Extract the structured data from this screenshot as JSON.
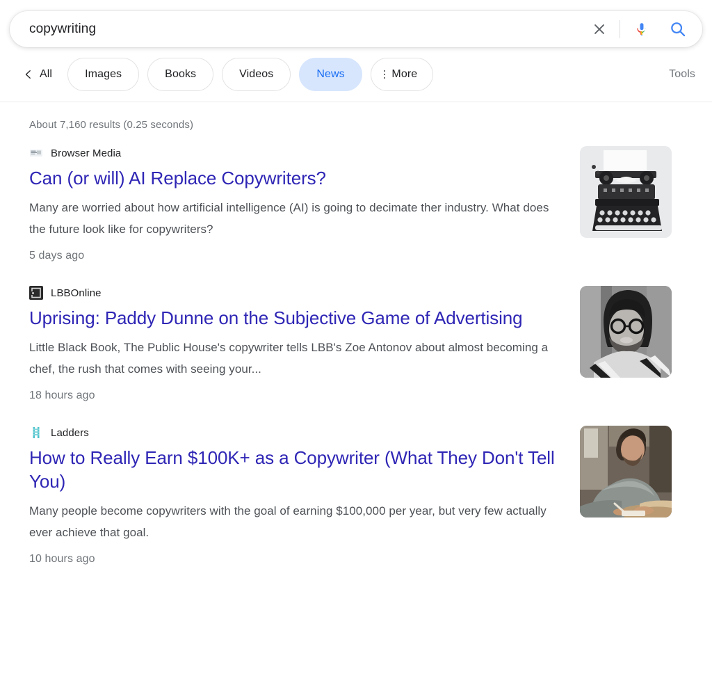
{
  "search": {
    "query": "copywriting",
    "placeholder": "Search",
    "clear_label": "Clear",
    "mic_label": "Search by voice",
    "submit_label": "Google Search"
  },
  "filters": {
    "back_label": "All",
    "chips": [
      {
        "label": "Images",
        "active": false
      },
      {
        "label": "Books",
        "active": false
      },
      {
        "label": "Videos",
        "active": false
      },
      {
        "label": "News",
        "active": true
      },
      {
        "label": "More",
        "active": false
      }
    ],
    "tools_label": "Tools"
  },
  "result_stats": "About 7,160 results (0.25 seconds)",
  "results": [
    {
      "source": "Browser Media",
      "favicon": "browser-media-favicon",
      "title": "Can (or will) AI Replace Copywriters?",
      "snippet": "Many are worried about how artificial intelligence (AI) is going to decimate ther industry. What does the future look like for copywriters?",
      "time": "5 days ago",
      "thumbnail": "typewriter-photo"
    },
    {
      "source": "LBBOnline",
      "favicon": "lbbonline-favicon",
      "title": "Uprising: Paddy Dunne on the Subjective Game of Advertising",
      "snippet": "Little Black Book, The Public House's copywriter tells LBB's Zoe Antonov about almost becoming a chef, the rush that comes with seeing your...",
      "time": "18 hours ago",
      "thumbnail": "man-portrait-photo"
    },
    {
      "source": "Ladders",
      "favicon": "ladders-favicon",
      "title": "How to Really Earn $100K+ as a Copywriter (What They Don't Tell You)",
      "snippet": "Many people become copywriters with the goal of earning $100,000 per year, but very few actually ever achieve that goal.",
      "time": "10 hours ago",
      "thumbnail": "man-writing-photo"
    }
  ],
  "colors": {
    "link": "#2f26b5",
    "active_chip_bg": "#d7e6fd",
    "active_chip_text": "#1b6ef3",
    "snippet_text": "#4d5156",
    "muted_text": "#70757a",
    "mic_blue": "#4285f4",
    "mic_red": "#ea4335",
    "mic_yellow": "#fbbc05",
    "mic_green": "#34a853",
    "search_blue": "#4285f4",
    "ladder_teal": "#4ec3cd"
  }
}
